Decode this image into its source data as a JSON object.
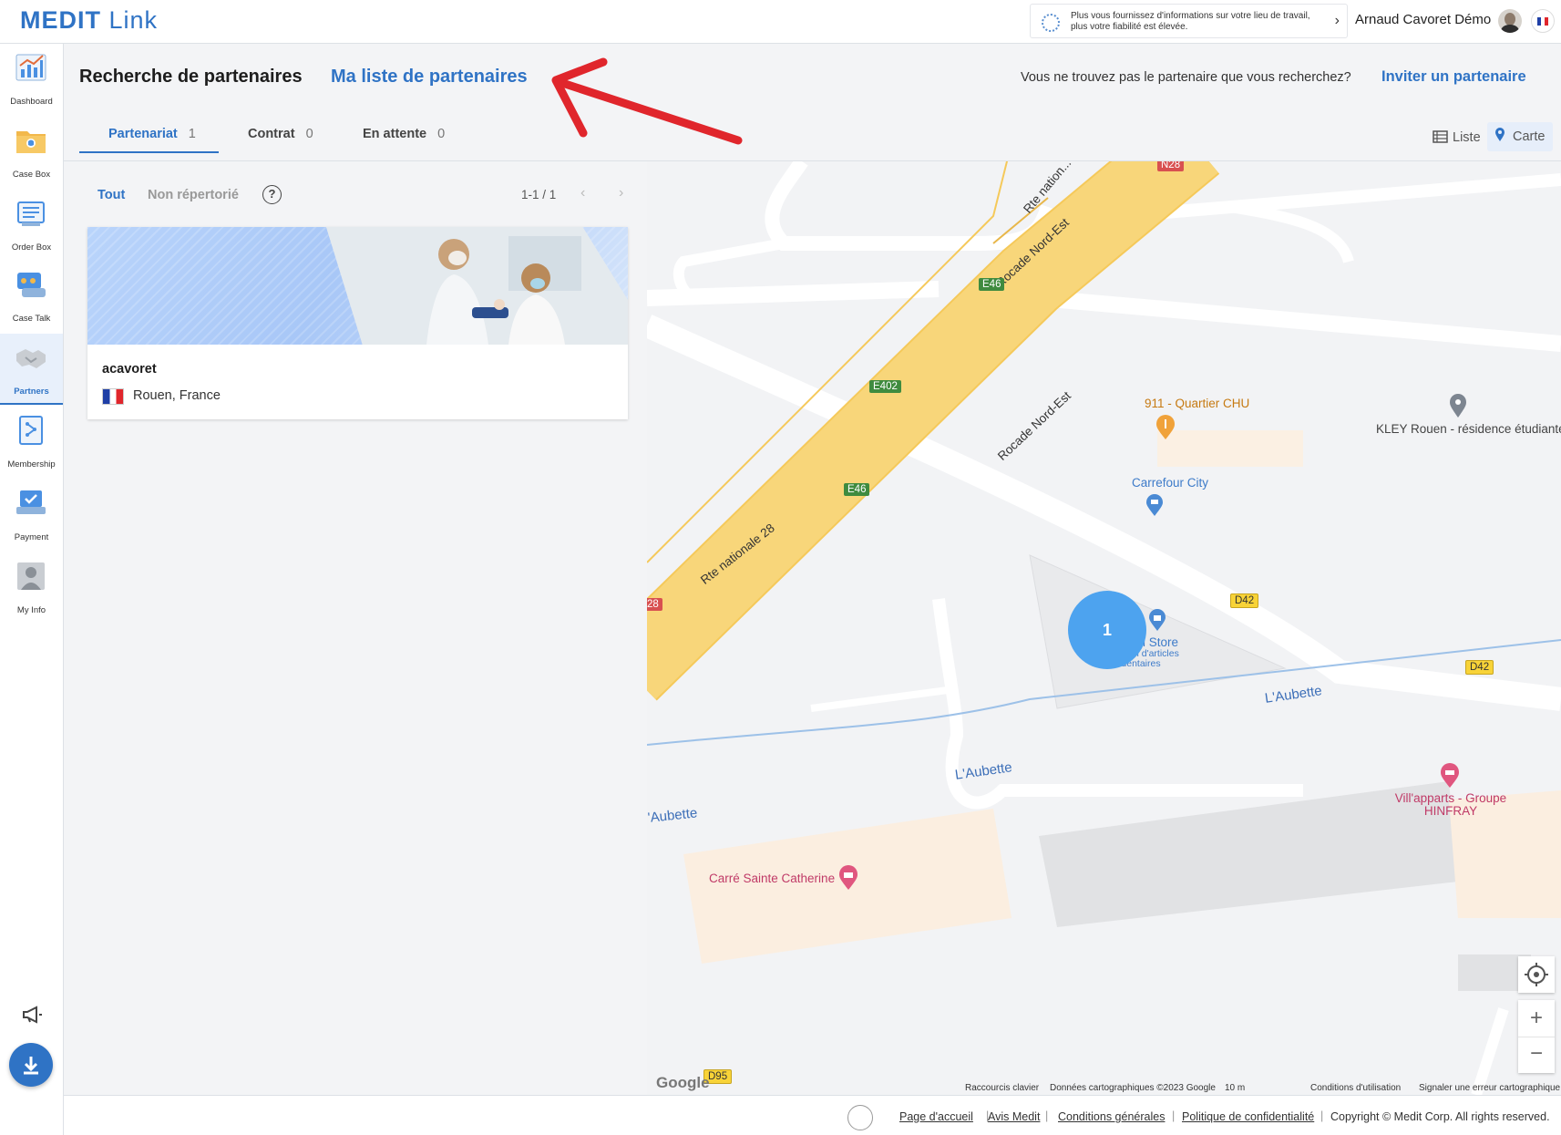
{
  "app": {
    "logo_bold": "MEDIT",
    "logo_light": " Link"
  },
  "topbar": {
    "notice_text": "Plus vous fournissez d'informations sur votre lieu de travail, plus votre fiabilité est élevée.",
    "username": "Arnaud Cavoret Démo"
  },
  "sidebar": {
    "items": [
      {
        "label": "Dashboard",
        "icon": "chart-icon"
      },
      {
        "label": "Case Box",
        "icon": "folder-icon"
      },
      {
        "label": "Order Box",
        "icon": "order-icon"
      },
      {
        "label": "Case Talk",
        "icon": "chat-icon"
      },
      {
        "label": "Partners",
        "icon": "handshake-icon"
      },
      {
        "label": "Membership",
        "icon": "membership-icon"
      },
      {
        "label": "Payment",
        "icon": "payment-icon"
      },
      {
        "label": "My Info",
        "icon": "user-icon"
      }
    ],
    "active": "Partners"
  },
  "header": {
    "title": "Recherche de partenaires",
    "my_list": "Ma liste de partenaires",
    "not_found": "Vous ne trouvez pas le partenaire que vous recherchez?",
    "invite": "Inviter un partenaire"
  },
  "tabs": [
    {
      "label": "Partenariat",
      "count": "1"
    },
    {
      "label": "Contrat",
      "count": "0"
    },
    {
      "label": "En attente",
      "count": "0"
    }
  ],
  "view": {
    "list": "Liste",
    "map": "Carte",
    "selected": "Carte"
  },
  "filters": {
    "all": "Tout",
    "unlisted": "Non répertorié",
    "help": "?"
  },
  "pager": {
    "range": "1-1 / 1",
    "prev": "‹",
    "next": "›"
  },
  "partner": {
    "name": "acavoret",
    "location": "Rouen, France"
  },
  "map": {
    "cluster_count": "1",
    "labels": {
      "rocade1": "Rocade Nord-Est",
      "rocade2": "Rocade Nord-Est",
      "rn28": "Rte nationale 28",
      "rnat_top": "Rte nation...",
      "quartier_chu": "911 - Quartier CHU",
      "kley": "KLEY Rouen - résidence étudiante",
      "carrefour": "Carrefour City",
      "store": "3D Dental Store",
      "store_sub": "Magasin d'articles dentaires",
      "aubette1": "L'Aubette",
      "aubette2": "L'Aubette",
      "aubette3": "'Aubette",
      "villapparts": "Vill'apparts - Groupe HINFRAY",
      "carre": "Carré Sainte Catherine"
    },
    "shields": {
      "e46_a": "E46",
      "e402": "E402",
      "e46_b": "E46",
      "d42_a": "D42",
      "d42_b": "D42",
      "n28_top": "N28",
      "n28_left": "28",
      "d95": "D95"
    },
    "attribution": {
      "shortcuts": "Raccourcis clavier",
      "data": "Données cartographiques ©2023 Google",
      "scale": "10 m",
      "terms": "Conditions d'utilisation",
      "report": "Signaler une erreur cartographique",
      "google": "Google"
    }
  },
  "footer": {
    "links": [
      "Page d'accueil",
      "Avis Medit",
      "Conditions générales",
      "Politique de confidentialité"
    ],
    "copyright": "Copyright © Medit Corp. All rights reserved."
  },
  "colors": {
    "accent": "#2f73c5",
    "road": "#f8d67a",
    "cluster": "#4da3ef",
    "arrow": "#e0262c"
  }
}
